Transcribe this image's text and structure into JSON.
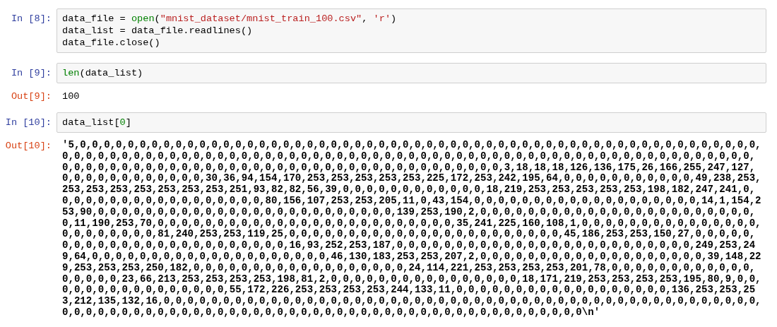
{
  "cells": [
    {
      "kind": "input",
      "prompt": "In [8]:",
      "lines": [
        [
          {
            "kind": "plain",
            "text": "data_file = "
          },
          {
            "kind": "builtin",
            "text": "open"
          },
          {
            "kind": "plain",
            "text": "("
          },
          {
            "kind": "string",
            "text": "\"mnist_dataset/mnist_train_100.csv\""
          },
          {
            "kind": "plain",
            "text": ", "
          },
          {
            "kind": "string",
            "text": "'r'"
          },
          {
            "kind": "plain",
            "text": ")"
          }
        ],
        [
          {
            "kind": "plain",
            "text": "data_list = data_file.readlines()"
          }
        ],
        [
          {
            "kind": "plain",
            "text": "data_file.close()"
          }
        ]
      ]
    },
    {
      "kind": "input",
      "prompt": "In [9]:",
      "lines": [
        [
          {
            "kind": "builtin",
            "text": "len"
          },
          {
            "kind": "plain",
            "text": "(data_list)"
          }
        ]
      ]
    },
    {
      "kind": "output",
      "prompt": "Out[9]:",
      "text": "100"
    },
    {
      "kind": "input",
      "prompt": "In [10]:",
      "lines": [
        [
          {
            "kind": "plain",
            "text": "data_list["
          },
          {
            "kind": "number",
            "text": "0"
          },
          {
            "kind": "plain",
            "text": "]"
          }
        ]
      ]
    },
    {
      "kind": "output",
      "prompt": "Out[10]:",
      "text": "'5,0,0,0,0,0,0,0,0,0,0,0,0,0,0,0,0,0,0,0,0,0,0,0,0,0,0,0,0,0,0,0,0,0,0,0,0,0,0,0,0,0,0,0,0,0,0,0,0,0,0,0,0,0,0,0,0,0,0,0,0,0,0,0,0,0,0,0,0,0,0,0,0,0,0,0,0,0,0,0,0,0,0,0,0,0,0,0,0,0,0,0,0,0,0,0,0,0,0,0,0,0,0,0,0,0,0,0,0,0,0,0,0,0,0,0,0,0,0,0,0,0,0,0,0,0,0,0,0,0,0,0,0,0,0,0,0,0,0,0,0,0,0,0,0,0,0,0,0,0,0,0,0,3,18,18,18,126,136,175,26,166,255,247,127,0,0,0,0,0,0,0,0,0,0,0,0,30,36,94,154,170,253,253,253,253,253,225,172,253,242,195,64,0,0,0,0,0,0,0,0,0,0,0,49,238,253,253,253,253,253,253,253,253,251,93,82,82,56,39,0,0,0,0,0,0,0,0,0,0,0,0,18,219,253,253,253,253,253,198,182,247,241,0,0,0,0,0,0,0,0,0,0,0,0,0,0,0,0,0,0,80,156,107,253,253,205,11,0,43,154,0,0,0,0,0,0,0,0,0,0,0,0,0,0,0,0,0,0,0,14,1,154,253,90,0,0,0,0,0,0,0,0,0,0,0,0,0,0,0,0,0,0,0,0,0,0,0,0,0,139,253,190,2,0,0,0,0,0,0,0,0,0,0,0,0,0,0,0,0,0,0,0,0,0,0,0,0,11,190,253,70,0,0,0,0,0,0,0,0,0,0,0,0,0,0,0,0,0,0,0,0,0,0,0,0,0,35,241,225,160,108,1,0,0,0,0,0,0,0,0,0,0,0,0,0,0,0,0,0,0,0,0,0,0,0,81,240,253,253,119,25,0,0,0,0,0,0,0,0,0,0,0,0,0,0,0,0,0,0,0,0,0,0,0,45,186,253,253,150,27,0,0,0,0,0,0,0,0,0,0,0,0,0,0,0,0,0,0,0,0,0,0,0,0,16,93,252,253,187,0,0,0,0,0,0,0,0,0,0,0,0,0,0,0,0,0,0,0,0,0,0,0,0,0,249,253,249,64,0,0,0,0,0,0,0,0,0,0,0,0,0,0,0,0,0,0,0,0,46,130,183,253,253,207,2,0,0,0,0,0,0,0,0,0,0,0,0,0,0,0,0,0,0,0,39,148,229,253,253,253,250,182,0,0,0,0,0,0,0,0,0,0,0,0,0,0,0,0,0,0,24,114,221,253,253,253,253,201,78,0,0,0,0,0,0,0,0,0,0,0,0,0,0,0,0,0,23,66,213,253,253,253,253,198,81,2,0,0,0,0,0,0,0,0,0,0,0,0,0,0,0,0,18,171,219,253,253,253,253,195,80,9,0,0,0,0,0,0,0,0,0,0,0,0,0,0,0,0,55,172,226,253,253,253,253,244,133,11,0,0,0,0,0,0,0,0,0,0,0,0,0,0,0,0,0,0,136,253,253,253,212,135,132,16,0,0,0,0,0,0,0,0,0,0,0,0,0,0,0,0,0,0,0,0,0,0,0,0,0,0,0,0,0,0,0,0,0,0,0,0,0,0,0,0,0,0,0,0,0,0,0,0,0,0,0,0,0,0,0,0,0,0,0,0,0,0,0,0,0,0,0,0,0,0,0,0,0,0,0,0,0,0,0,0,0,0,0,0,0,0,0,0,0,0,0,0,0,0\\n'"
    }
  ]
}
